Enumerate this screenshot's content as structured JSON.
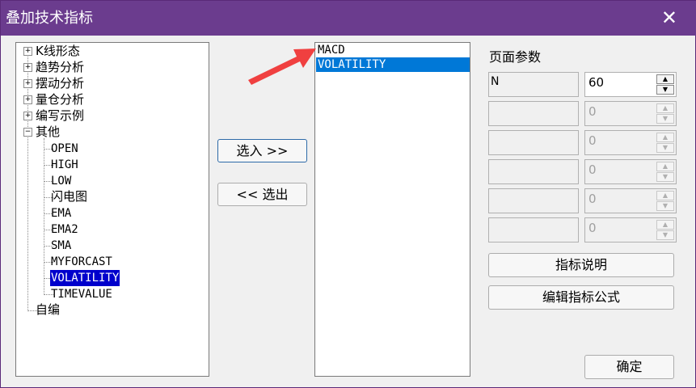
{
  "window": {
    "title": "叠加技术指标",
    "close_glyph": "✕"
  },
  "tree": {
    "plus": "+",
    "minus": "−",
    "groups": [
      "K线形态",
      "趋势分析",
      "摆动分析",
      "量仓分析",
      "编写示例",
      "其他"
    ],
    "children": [
      "OPEN",
      "HIGH",
      "LOW",
      "闪电图",
      "EMA",
      "EMA2",
      "SMA",
      "MYFORCAST",
      "VOLATILITY",
      "TIMEVALUE"
    ],
    "selected": "VOLATILITY",
    "last": "自编"
  },
  "buttons": {
    "add": "选入 >>",
    "remove": "<< 选出",
    "describe": "指标说明",
    "edit_formula": "编辑指标公式",
    "ok": "确定"
  },
  "selected_list": {
    "items": [
      "MACD",
      "VOLATILITY"
    ],
    "selected": "VOLATILITY"
  },
  "params": {
    "group_label": "页面参数",
    "rows": [
      {
        "name": "N",
        "value": "60",
        "enabled": true
      },
      {
        "name": "",
        "value": "0",
        "enabled": false
      },
      {
        "name": "",
        "value": "0",
        "enabled": false
      },
      {
        "name": "",
        "value": "0",
        "enabled": false
      },
      {
        "name": "",
        "value": "0",
        "enabled": false
      },
      {
        "name": "",
        "value": "0",
        "enabled": false
      }
    ]
  },
  "colors": {
    "titlebar": "#6b3c8e",
    "selection": "#0078d7",
    "tree_selection": "#0000cc",
    "arrow": "#f04040"
  },
  "icons": {
    "close": "close-icon",
    "expand": "plus-box-icon",
    "collapse": "minus-box-icon",
    "arrow": "red-arrow-annotation-icon",
    "spin_up": "spin-up-icon",
    "spin_down": "spin-down-icon"
  },
  "spin": {
    "up": "▲",
    "down": "▼"
  }
}
